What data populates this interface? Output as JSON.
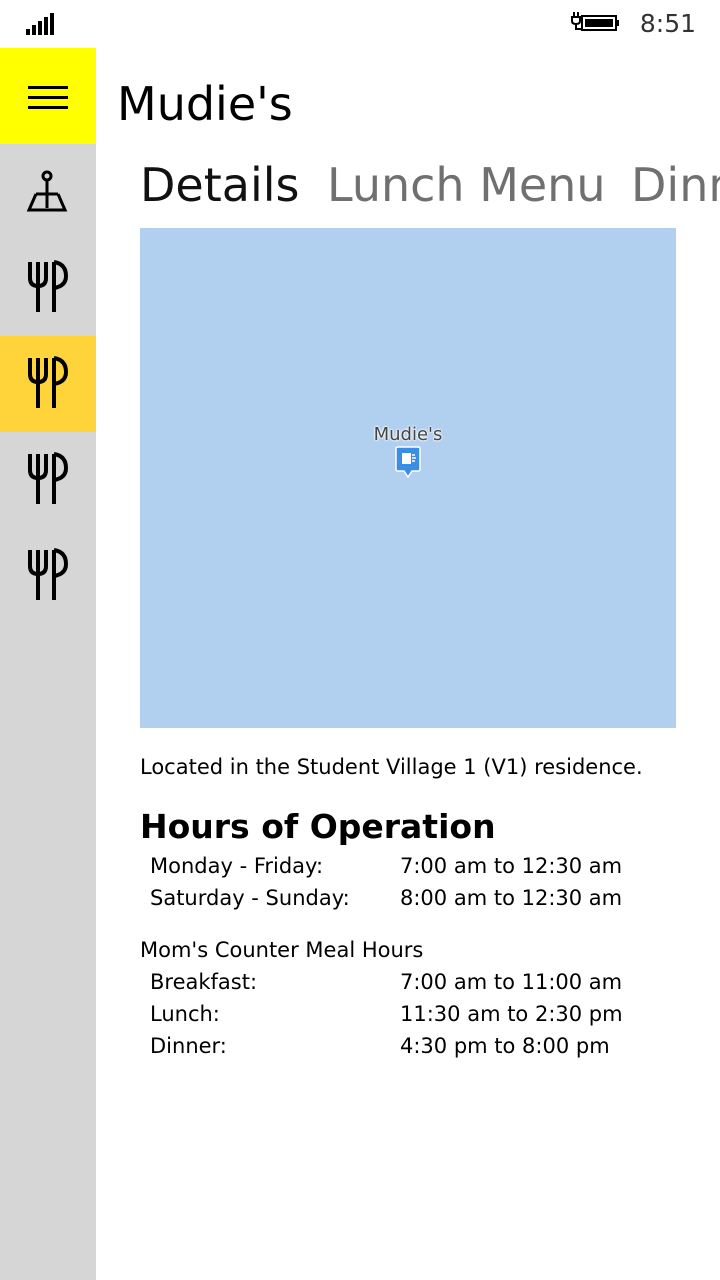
{
  "status_bar": {
    "time": "8:51",
    "signal_icon": "signal-bars-icon",
    "battery_icon": "battery-charging-icon"
  },
  "sidebar": {
    "menu_icon": "hamburger-menu-icon",
    "items": [
      {
        "icon": "scale-map-icon",
        "active": false
      },
      {
        "icon": "fork-knife-icon",
        "active": false
      },
      {
        "icon": "fork-knife-icon",
        "active": true
      },
      {
        "icon": "fork-knife-icon",
        "active": false
      },
      {
        "icon": "fork-knife-icon",
        "active": false
      }
    ]
  },
  "header": {
    "title": "Mudie's"
  },
  "tabs": [
    {
      "label": "Details",
      "selected": true
    },
    {
      "label": "Lunch Menu",
      "selected": false
    },
    {
      "label": "Dinner Menu",
      "selected": false
    }
  ],
  "map": {
    "pin_label": "Mudie's",
    "pin_icon": "map-pin-icon"
  },
  "details": {
    "location": "Located in the Student Village 1 (V1) residence.",
    "hours_heading": "Hours of Operation",
    "hours": [
      {
        "day": "Monday - Friday:",
        "time": "7:00 am to 12:30 am"
      },
      {
        "day": "Saturday - Sunday:",
        "time": "8:00 am to 12:30 am"
      }
    ],
    "counter_heading": "Mom's Counter Meal Hours",
    "counter_hours": [
      {
        "meal": "Breakfast:",
        "time": "7:00 am to 11:00 am"
      },
      {
        "meal": "Lunch:",
        "time": "11:30 am to 2:30 pm"
      },
      {
        "meal": "Dinner:",
        "time": "4:30 pm to 8:00 pm"
      }
    ]
  },
  "colors": {
    "accent_menu": "#ffff00",
    "accent_active": "#ffd33a",
    "sidebar_bg": "#d6d6d6",
    "map_water": "#b1cfee"
  }
}
